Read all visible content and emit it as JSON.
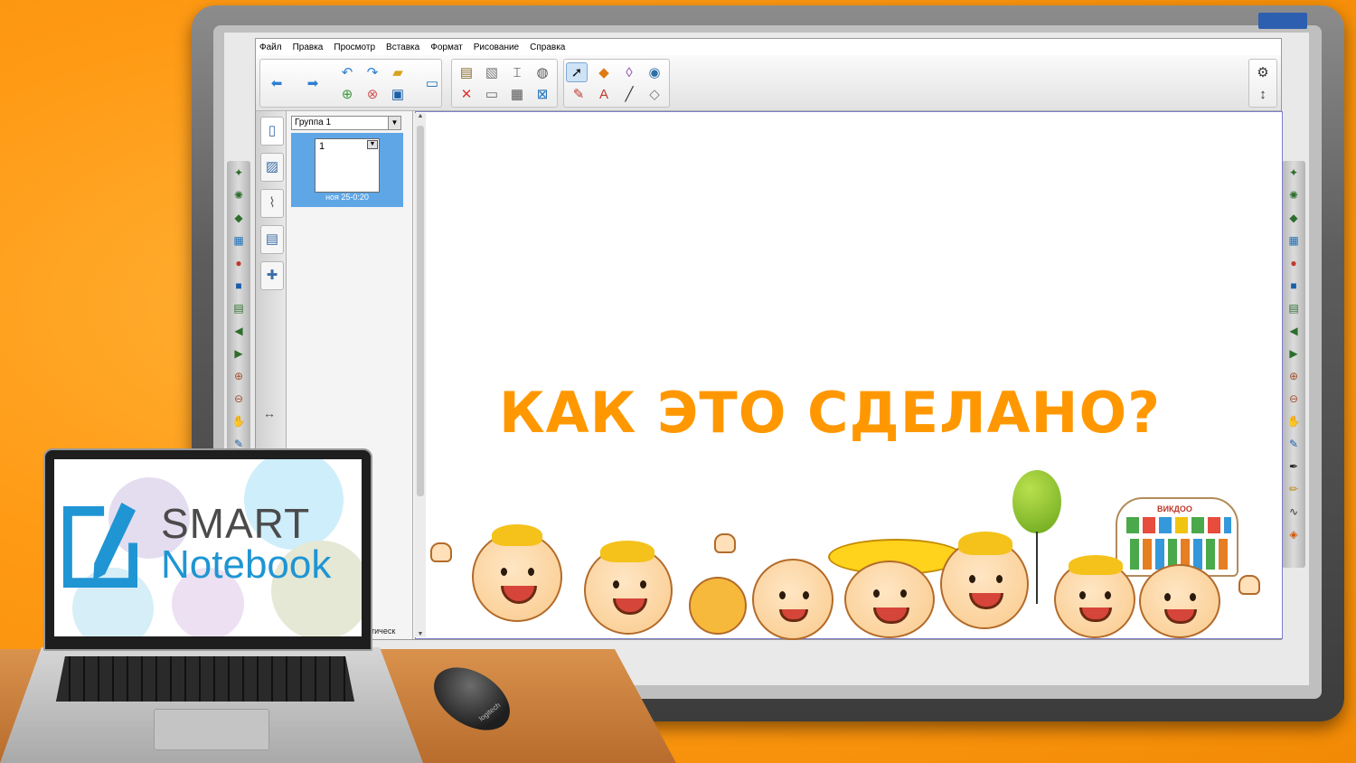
{
  "menu": [
    "Файл",
    "Правка",
    "Просмотр",
    "Вставка",
    "Формат",
    "Рисование",
    "Справка"
  ],
  "sorter": {
    "group_label": "Группа 1",
    "page_number": "1",
    "page_date": "ноя 25-0:20",
    "auto_hide_label": "матическ"
  },
  "canvas": {
    "headline": "КАК ЭТО СДЕЛАНО?",
    "sign_label": "ВИКДОО"
  },
  "laptop": {
    "brand_top": "SMART",
    "brand_bottom": "Notebook"
  },
  "mouse_brand": "logitech",
  "colors": {
    "headline": "#ff9800",
    "background": "#ff9a14",
    "brand_blue": "#1f95d3",
    "brand_gray": "#4b4b4b"
  },
  "icons": {
    "toolbar": [
      "back-arrow-icon",
      "forward-arrow-icon",
      "undo-icon",
      "redo-icon",
      "open-folder-icon",
      "add-page-icon",
      "delete-page-icon",
      "save-icon",
      "screen-shade-icon",
      "paste-icon",
      "clear-page-icon",
      "delete-icon",
      "document-camera-icon",
      "display-icon",
      "table-icon",
      "capture-icon",
      "select-icon",
      "pens-icon",
      "shapes-icon",
      "text-icon",
      "eraser-icon",
      "lines-icon",
      "fill-icon",
      "magic-pen-icon",
      "settings-icon",
      "move-toolbar-icon"
    ]
  }
}
